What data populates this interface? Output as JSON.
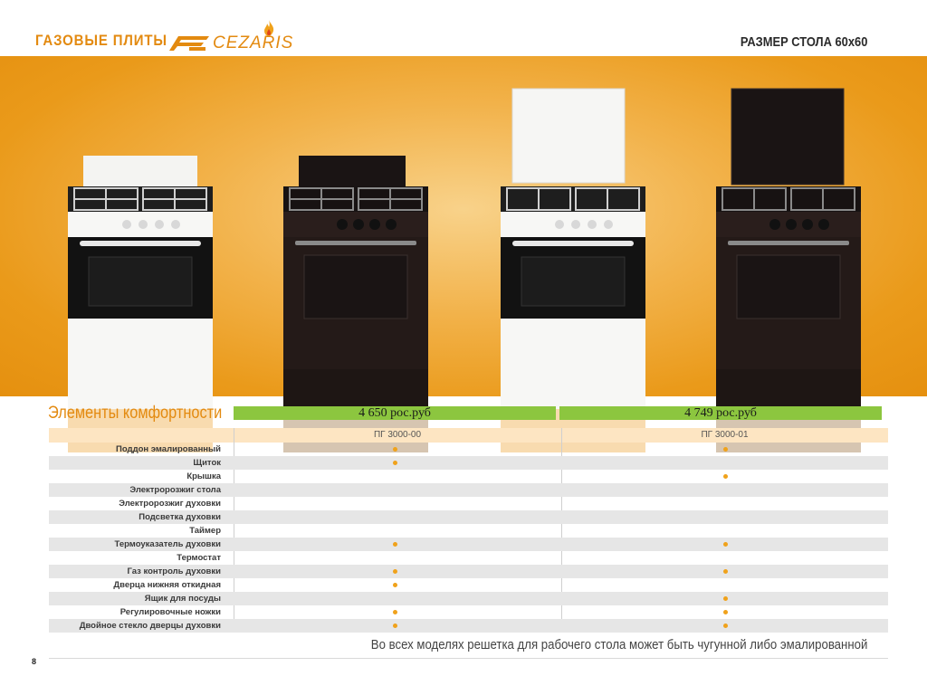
{
  "header": {
    "series_title": "ГАЗОВЫЕ ПЛИТЫ",
    "brand_name": "CEZARIS",
    "table_size": "РАЗМЕР СТОЛА 60х60"
  },
  "comfort": {
    "title": "Элементы комфортности",
    "prices": [
      "4 650 рос.руб",
      "4 749 рос.руб"
    ],
    "models": [
      "ПГ 3000-00",
      "ПГ 3000-01"
    ],
    "features": [
      {
        "label": "Поддон эмалированный",
        "m1": true,
        "m2": true
      },
      {
        "label": "Щиток",
        "m1": true,
        "m2": false
      },
      {
        "label": "Крышка",
        "m1": false,
        "m2": true
      },
      {
        "label": "Электророзжиг стола",
        "m1": false,
        "m2": false
      },
      {
        "label": "Электророзжиг духовки",
        "m1": false,
        "m2": false
      },
      {
        "label": "Подсветка духовки",
        "m1": false,
        "m2": false
      },
      {
        "label": "Таймер",
        "m1": false,
        "m2": false
      },
      {
        "label": "Термоуказатель духовки",
        "m1": true,
        "m2": true
      },
      {
        "label": "Термостат",
        "m1": false,
        "m2": false
      },
      {
        "label": "Газ контроль духовки",
        "m1": true,
        "m2": true
      },
      {
        "label": "Дверца нижняя откидная",
        "m1": true,
        "m2": false
      },
      {
        "label": "Ящик для посуды",
        "m1": false,
        "m2": true
      },
      {
        "label": "Регулировочные ножки",
        "m1": true,
        "m2": true
      },
      {
        "label": "Двойное стекло дверцы духовки",
        "m1": true,
        "m2": true
      }
    ]
  },
  "footnote": "Во всех моделях решетка для рабочего стола может быть чугунной либо эмалированной",
  "page_number": "8",
  "colors": {
    "accent": "#e38a10",
    "price_bar": "#8cc63f",
    "dot": "#f0a21b"
  }
}
